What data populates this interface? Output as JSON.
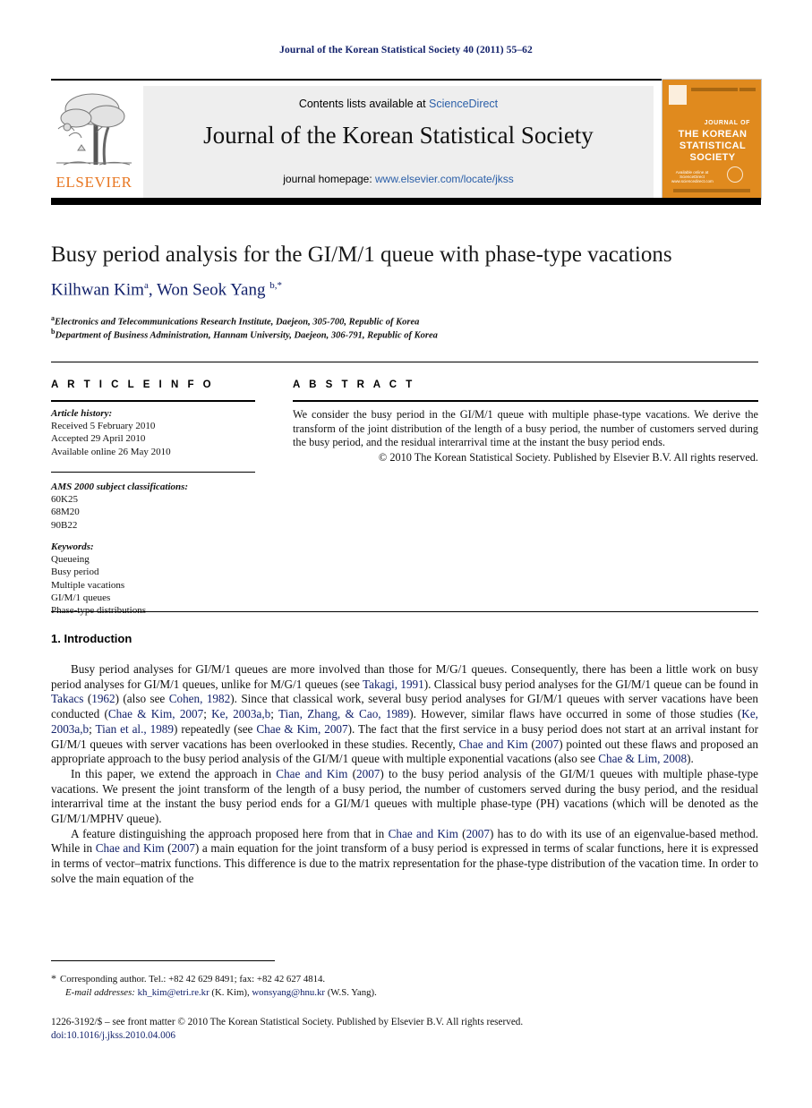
{
  "running_head": "Journal of the Korean Statistical Society 40 (2011) 55–62",
  "masthead": {
    "contents_prefix": "Contents lists available at ",
    "contents_link": "ScienceDirect",
    "journal_title": "Journal of the Korean Statistical Society",
    "homepage_prefix": "journal homepage: ",
    "homepage_link": "www.elsevier.com/locate/jkss",
    "publisher_logo_text": "ELSEVIER",
    "cover_title_line1": "JOURNAL OF",
    "cover_title_line2": "THE KOREAN",
    "cover_title_line3": "STATISTICAL",
    "cover_title_line4": "SOCIETY",
    "cover_badge_line1": "Available online at",
    "cover_badge_line2": "ScienceDirect",
    "cover_badge_line3": "www.sciencedirect.com",
    "accent_orange": "#E08A1E",
    "link_blue": "#2b5fa8"
  },
  "article": {
    "title": "Busy period analysis for the GI/M/1 queue with phase-type vacations",
    "authors_html": "Kilhwan Kim<sup>a</sup>, Won Seok Yang <sup>b,*</sup>",
    "affiliation_a_marker": "a",
    "affiliation_a": "Electronics and Telecommunications Research Institute, Daejeon, 305-700, Republic of Korea",
    "affiliation_b_marker": "b",
    "affiliation_b": "Department of Business Administration, Hannam University, Daejeon, 306-791, Republic of Korea"
  },
  "info": {
    "heading": "A R T I C L E    I N F O",
    "history_label": "Article history:",
    "history": [
      "Received 5 February 2010",
      "Accepted 29 April 2010",
      "Available online 26 May 2010"
    ],
    "ams_label": "AMS 2000 subject classifications:",
    "ams_codes": [
      "60K25",
      "68M20",
      "90B22"
    ],
    "keywords_label": "Keywords:",
    "keywords": [
      "Queueing",
      "Busy period",
      "Multiple vacations",
      "GI/M/1 queues",
      "Phase-type distributions"
    ]
  },
  "abstract": {
    "heading": "A B S T R A C T",
    "text": "We consider the busy period in the GI/M/1 queue with multiple phase-type vacations. We derive the transform of the joint distribution of the length of a busy period, the number of customers served during the busy period, and the residual interarrival time at the instant the busy period ends.",
    "copyright": "© 2010 The Korean Statistical Society. Published by Elsevier B.V. All rights reserved."
  },
  "body": {
    "section_heading": "1. Introduction",
    "paragraphs": [
      "Busy period analyses for GI/M/1 queues are more involved than those for M/G/1 queues. Consequently, there has been a little work on busy period analyses for GI/M/1 queues, unlike for M/G/1 queues (see @Takagi, 1991@). Classical busy period analyses for the GI/M/1 queue can be found in @Takacs@ (@1962@) (also see @Cohen, 1982@). Since that classical work, several busy period analyses for GI/M/1 queues with server vacations have been conducted (@Chae & Kim, 2007@; @Ke, 2003a,b@; @Tian, Zhang, & Cao, 1989@). However, similar flaws have occurred in some of those studies (@Ke, 2003a,b@; @Tian et al., 1989@) repeatedly (see @Chae & Kim, 2007@). The fact that the first service in a busy period does not start at an arrival instant for GI/M/1 queues with server vacations has been overlooked in these studies. Recently, @Chae and Kim@ (@2007@) pointed out these flaws and proposed an appropriate approach to the busy period analysis of the GI/M/1 queue with multiple exponential vacations (also see @Chae & Lim, 2008@).",
      "In this paper, we extend the approach in @Chae and Kim@ (@2007@) to the busy period analysis of the GI/M/1 queues with multiple phase-type vacations. We present the joint transform of the length of a busy period, the number of customers served during the busy period, and the residual interarrival time at the instant the busy period ends for a GI/M/1 queues with multiple phase-type (PH) vacations (which will be denoted as the GI/M/1/MPHV queue).",
      "A feature distinguishing the approach proposed here from that in @Chae and Kim@ (@2007@) has to do with its use of an eigenvalue-based method. While in @Chae and Kim@ (@2007@) a main equation for the joint transform of a busy period is expressed in terms of scalar functions, here it is expressed in terms of vector–matrix functions. This difference is due to the matrix representation for the phase-type distribution of the vacation time. In order to solve the main equation of the"
    ]
  },
  "footnotes": {
    "corresponding_marker": "*",
    "corresponding": "Corresponding author. Tel.: +82 42 629 8491; fax: +82 42 627 4814.",
    "email_label": "E-mail addresses:",
    "email_1": "kh_kim@etri.re.kr",
    "email_1_who": "(K. Kim),",
    "email_2": "wonsyang@hnu.kr",
    "email_2_who": "(W.S. Yang)."
  },
  "colophon": {
    "line": "1226-3192/$ – see front matter © 2010 The Korean Statistical Society. Published by Elsevier B.V. All rights reserved.",
    "doi": "doi:10.1016/j.jkss.2010.04.006"
  }
}
